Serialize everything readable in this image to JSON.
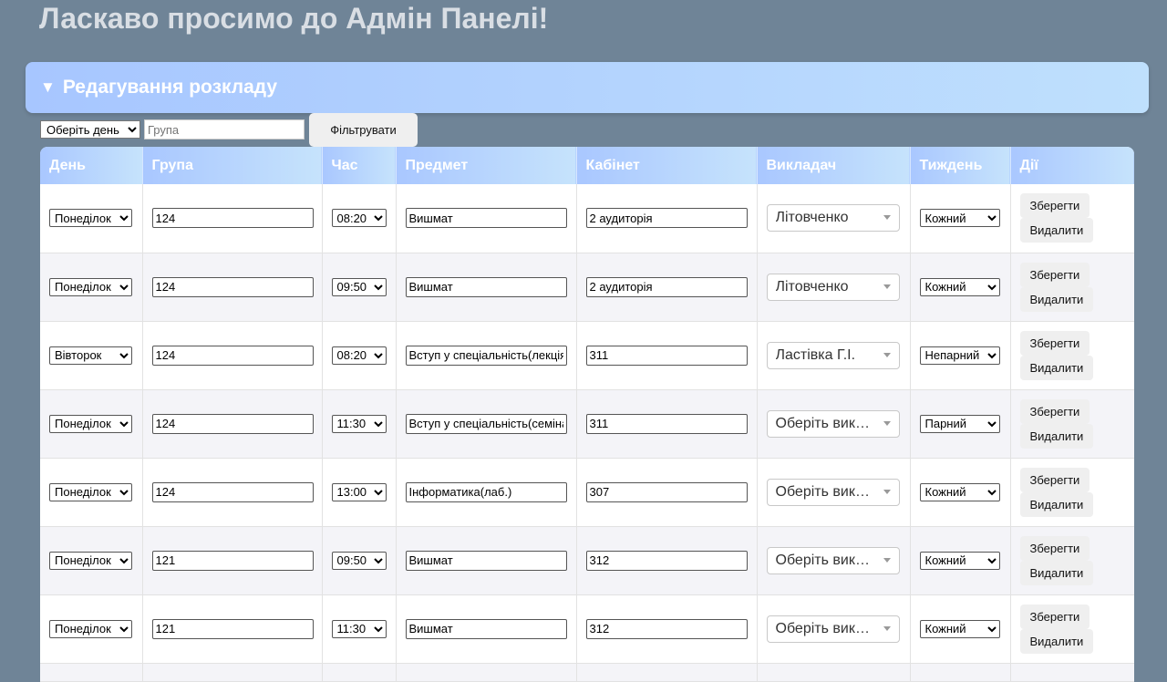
{
  "page_title": "Ласкаво просимо до Адмін Панелі!",
  "section": {
    "toggle": "▼",
    "title": "Редагування розкладу"
  },
  "filter": {
    "day_placeholder": "Оберіть день",
    "group_placeholder": "Група",
    "button_label": "Фільтрувати"
  },
  "columns": [
    "День",
    "Група",
    "Час",
    "Предмет",
    "Кабінет",
    "Викладач",
    "Тиждень",
    "Дії"
  ],
  "actions": {
    "save": "Зберегти",
    "delete": "Видалити"
  },
  "rows": [
    {
      "day": "Понеділок",
      "group": "124",
      "time": "08:20",
      "subject": "Вишмат",
      "room": "2 аудиторія",
      "teacher": "Літовченко",
      "week": "Кожний"
    },
    {
      "day": "Понеділок",
      "group": "124",
      "time": "09:50",
      "subject": "Вишмат",
      "room": "2 аудиторія",
      "teacher": "Літовченко",
      "week": "Кожний"
    },
    {
      "day": "Вівторок",
      "group": "124",
      "time": "08:20",
      "subject": "Вступ у спеціальність(лекція)",
      "room": "311",
      "teacher": "Ластівка Г.І.",
      "week": "Непарний"
    },
    {
      "day": "Понеділок",
      "group": "124",
      "time": "11:30",
      "subject": "Вступ у спеціальність(семінар)",
      "room": "311",
      "teacher": "Оберіть викладача",
      "week": "Парний"
    },
    {
      "day": "Понеділок",
      "group": "124",
      "time": "13:00",
      "subject": "Інформатика(лаб.)",
      "room": "307",
      "teacher": "Оберіть викладача",
      "week": "Кожний"
    },
    {
      "day": "Понеділок",
      "group": "121",
      "time": "09:50",
      "subject": "Вишмат",
      "room": "312",
      "teacher": "Оберіть викладача",
      "week": "Кожний"
    },
    {
      "day": "Понеділок",
      "group": "121",
      "time": "11:30",
      "subject": "Вишмат",
      "room": "312",
      "teacher": "Оберіть викладача",
      "week": "Кожний"
    }
  ],
  "colors": {
    "background": "#6f8497",
    "header_gradient_start": "#a9c7ff",
    "header_gradient_end": "#c6e3fc",
    "title_text": "#d9dee4"
  }
}
